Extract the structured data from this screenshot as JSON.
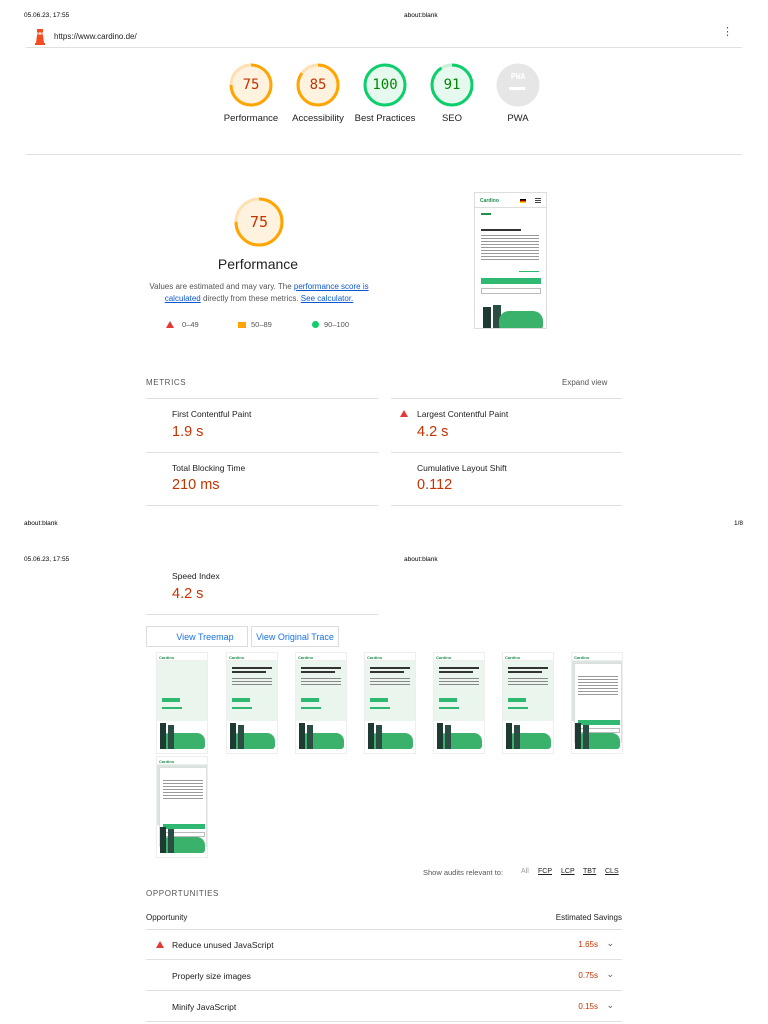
{
  "print_header_1": {
    "date": "05.06.23, 17:55",
    "title": "about:blank"
  },
  "url_bar": {
    "url": "https://www.cardino.de/"
  },
  "categories": [
    {
      "label": "Performance",
      "score": "75",
      "color": "#ffa400"
    },
    {
      "label": "Accessibility",
      "score": "85",
      "color": "#ffa400"
    },
    {
      "label": "Best Practices",
      "score": "100",
      "color": "#0cce6b"
    },
    {
      "label": "SEO",
      "score": "91",
      "color": "#0cce6b"
    },
    {
      "label": "PWA",
      "score": "PWA",
      "color": "#cccccc"
    }
  ],
  "performance": {
    "score": "75",
    "title": "Performance",
    "desc_prefix": "Values are estimated and may vary. The ",
    "desc_link": "performance score is calculated",
    "desc_middle": " directly from these metrics. ",
    "desc_calc": "See calculator.",
    "legend": {
      "fail": "0–49",
      "average": "50–89",
      "pass": "90–100"
    }
  },
  "metrics": {
    "heading": "METRICS",
    "expand": "Expand view",
    "fcp": {
      "label": "First Contentful Paint",
      "value": "1.9 s"
    },
    "lcp": {
      "label": "Largest Contentful Paint",
      "value": "4.2 s"
    },
    "tbt": {
      "label": "Total Blocking Time",
      "value": "210 ms"
    },
    "cls": {
      "label": "Cumulative Layout Shift",
      "value": "0.112"
    },
    "si": {
      "label": "Speed Index",
      "value": "4.2 s"
    }
  },
  "print_footer_1": {
    "left": "about:blank",
    "right": "1/8"
  },
  "print_header_2": {
    "date": "05.06.23, 17:55",
    "title": "about:blank"
  },
  "buttons": {
    "treemap": "View Treemap",
    "trace": "View Original Trace"
  },
  "thumb_text": {
    "logo": "Cardino"
  },
  "filter": {
    "label": "Show audits relevant to:",
    "all": "All",
    "fcp": "FCP",
    "lcp": "LCP",
    "tbt": "TBT",
    "cls": "CLS"
  },
  "opportunities": {
    "heading": "OPPORTUNITIES",
    "col_opportunity": "Opportunity",
    "col_savings": "Estimated Savings",
    "items": [
      {
        "label": "Reduce unused JavaScript",
        "saving": "1.65s"
      },
      {
        "label": "Properly size images",
        "saving": "0.75s"
      },
      {
        "label": "Minify JavaScript",
        "saving": "0.15s"
      }
    ]
  }
}
